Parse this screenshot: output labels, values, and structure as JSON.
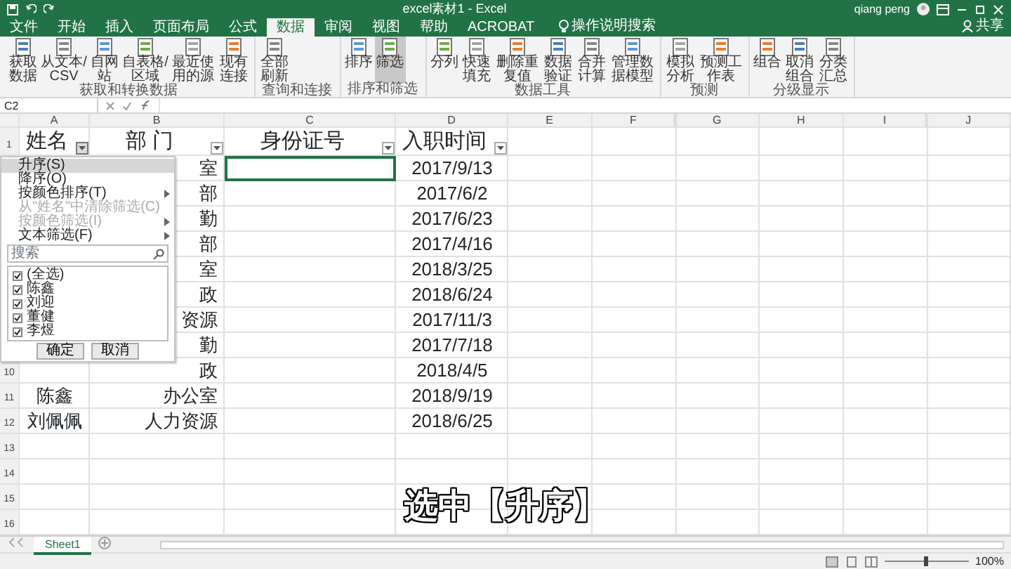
{
  "window": {
    "title": "excel素材1 - Excel",
    "user": "qiang peng"
  },
  "tabs": [
    {
      "label": "文件",
      "selected": false
    },
    {
      "label": "开始",
      "selected": false
    },
    {
      "label": "插入",
      "selected": false
    },
    {
      "label": "页面布局",
      "selected": false
    },
    {
      "label": "公式",
      "selected": false
    },
    {
      "label": "数据",
      "selected": true
    },
    {
      "label": "审阅",
      "selected": false
    },
    {
      "label": "视图",
      "selected": false
    },
    {
      "label": "帮助",
      "selected": false
    },
    {
      "label": "ACROBAT",
      "selected": false
    }
  ],
  "tell_me": "操作说明搜索",
  "share": "共享",
  "ribbon_groups": [
    {
      "label": "获取和转换数据",
      "buttons": [
        {
          "label": "获取数据",
          "selected": false
        },
        {
          "label": "从文本/CSV",
          "selected": false
        },
        {
          "label": "自网站",
          "selected": false
        },
        {
          "label": "自表格/区域",
          "selected": false
        },
        {
          "label": "最近使用的源",
          "selected": false
        },
        {
          "label": "现有连接",
          "selected": false
        }
      ]
    },
    {
      "label": "查询和连接",
      "buttons": [
        {
          "label": "全部刷新",
          "selected": false
        }
      ]
    },
    {
      "label": "排序和筛选",
      "buttons": [
        {
          "label": "排序",
          "selected": false
        },
        {
          "label": "筛选",
          "selected": true
        }
      ]
    },
    {
      "label": "数据工具",
      "buttons": [
        {
          "label": "分列",
          "selected": false
        },
        {
          "label": "快速填充",
          "selected": false
        },
        {
          "label": "删除重复值",
          "selected": false
        },
        {
          "label": "数据验证",
          "selected": false
        },
        {
          "label": "合并计算",
          "selected": false
        },
        {
          "label": "管理数据模型",
          "selected": false
        }
      ]
    },
    {
      "label": "预测",
      "buttons": [
        {
          "label": "模拟分析",
          "selected": false
        },
        {
          "label": "预测工作表",
          "selected": false
        }
      ]
    },
    {
      "label": "分级显示",
      "buttons": [
        {
          "label": "组合",
          "selected": false
        },
        {
          "label": "取消组合",
          "selected": false
        },
        {
          "label": "分类汇总",
          "selected": false
        }
      ]
    }
  ],
  "name_box": "C2",
  "columns": [
    {
      "letter": "A",
      "header": "姓名",
      "menu_open": true
    },
    {
      "letter": "B",
      "header": "部 门",
      "menu_open": false
    },
    {
      "letter": "C",
      "header": "身份证号",
      "menu_open": false
    },
    {
      "letter": "D",
      "header": "入职时间",
      "menu_open": false
    },
    {
      "letter": "E"
    },
    {
      "letter": "F"
    },
    {
      "letter": "G"
    },
    {
      "letter": "H"
    },
    {
      "letter": "I"
    },
    {
      "letter": "J"
    }
  ],
  "header_row": "1",
  "rows": [
    {
      "dept": "室",
      "date": "2017/9/13",
      "id_selected": true
    },
    {
      "dept": "部",
      "date": "2017/6/2",
      "id_selected": false
    },
    {
      "dept": "勤",
      "date": "2017/6/23",
      "id_selected": false
    },
    {
      "dept": "部",
      "date": "2017/4/16",
      "id_selected": false
    },
    {
      "dept": "室",
      "date": "2018/3/25",
      "id_selected": false
    },
    {
      "dept": "政",
      "date": "2018/6/24",
      "id_selected": false
    },
    {
      "dept": "资源",
      "date": "2017/11/3",
      "id_selected": false
    },
    {
      "dept": "勤",
      "date": "2017/7/18",
      "id_selected": false
    },
    {
      "number": "10",
      "dept": "政",
      "date": "2018/4/5",
      "id_selected": false
    },
    {
      "number": "11",
      "name": "陈鑫",
      "dept": "办公室",
      "date": "2018/9/19",
      "id_selected": false
    },
    {
      "number": "12",
      "name": "刘佩佩",
      "dept": "人力资源",
      "date": "2018/6/25",
      "id_selected": false
    },
    {
      "number": "13",
      "id_selected": false
    },
    {
      "number": "14",
      "id_selected": false
    },
    {
      "number": "15",
      "id_selected": false
    },
    {
      "number": "16",
      "id_selected": false
    }
  ],
  "filter_menu": {
    "items": [
      {
        "label": "升序(S)",
        "selected": true,
        "disabled": false,
        "submenu": false
      },
      {
        "label": "降序(O)",
        "selected": false,
        "disabled": false,
        "submenu": false
      },
      {
        "label": "按颜色排序(T)",
        "selected": false,
        "disabled": false,
        "submenu": true
      },
      {
        "label": "从\"姓名\"中清除筛选(C)",
        "selected": false,
        "disabled": true,
        "submenu": false
      },
      {
        "label": "按颜色筛选(I)",
        "selected": false,
        "disabled": true,
        "submenu": true
      },
      {
        "label": "文本筛选(F)",
        "selected": false,
        "disabled": false,
        "submenu": true
      }
    ],
    "search_placeholder": "搜索",
    "values": [
      {
        "label": "(全选)",
        "checked": true
      },
      {
        "label": "陈鑫",
        "checked": true
      },
      {
        "label": "刘迎",
        "checked": true
      },
      {
        "label": "董健",
        "checked": true
      },
      {
        "label": "李煜",
        "checked": true
      }
    ],
    "buttons": [
      "确定",
      "取消"
    ]
  },
  "caption": "选中【升序】",
  "sheet_tabs": [
    {
      "label": "Sheet1",
      "selected": true
    }
  ],
  "zoom": {
    "level": 0.5,
    "label": "100%"
  }
}
